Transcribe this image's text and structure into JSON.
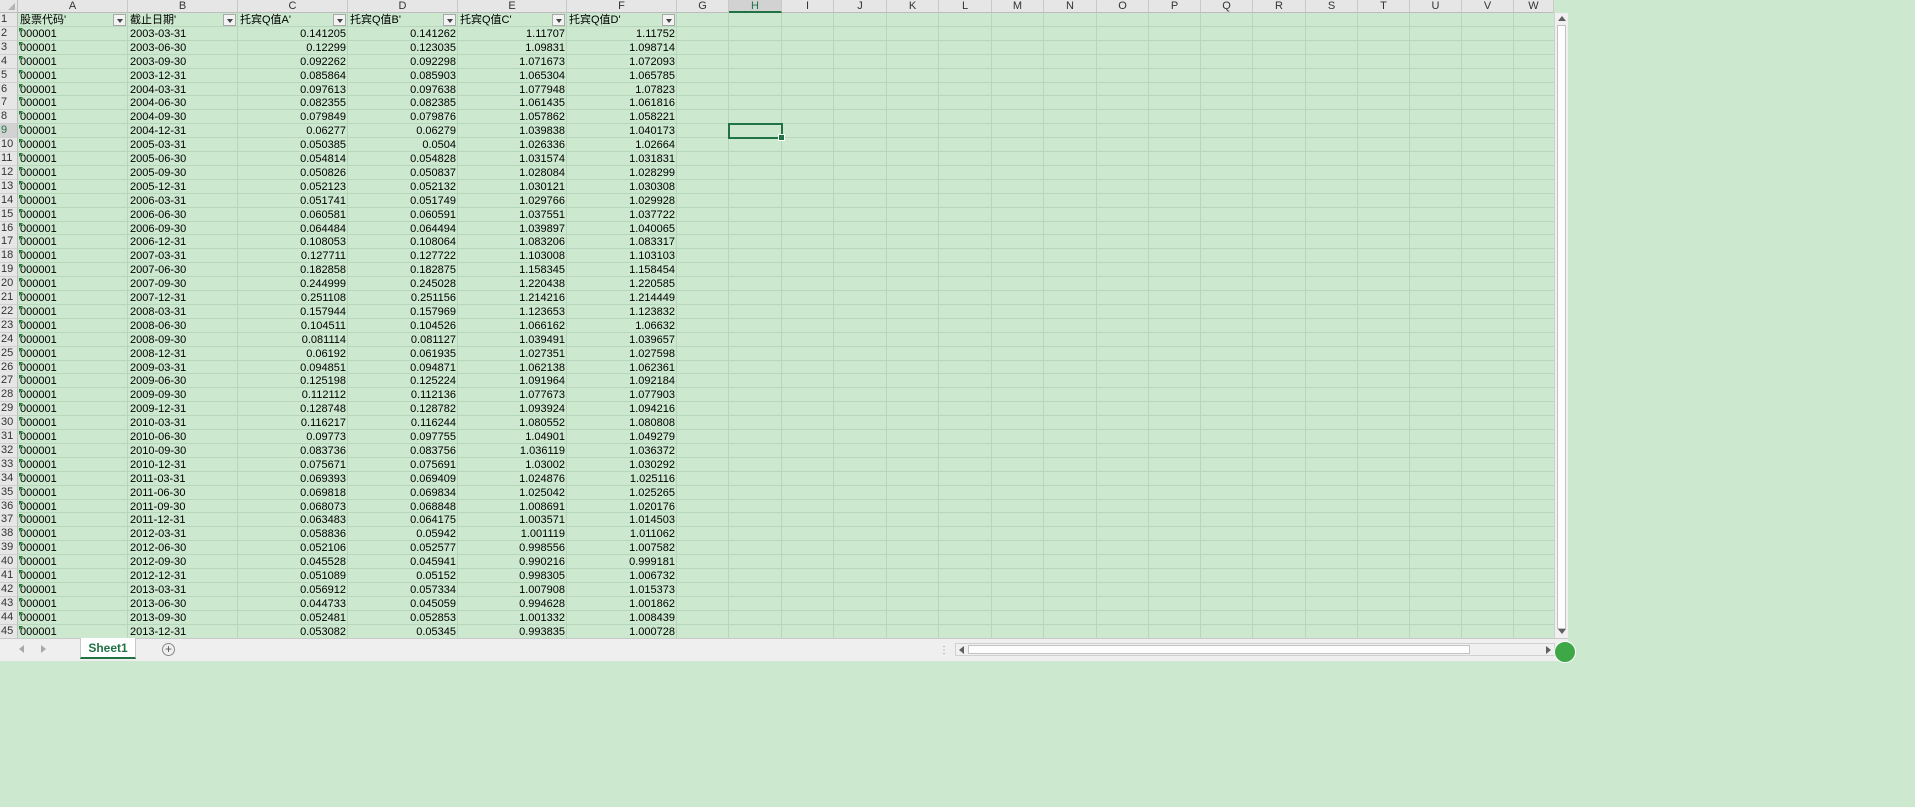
{
  "columns": [
    "A",
    "B",
    "C",
    "D",
    "E",
    "F",
    "G",
    "H",
    "I",
    "J",
    "K",
    "L",
    "M",
    "N",
    "O",
    "P",
    "Q",
    "R",
    "S",
    "T",
    "U",
    "V",
    "W"
  ],
  "selected_column": "H",
  "selected_row": "9",
  "sheet": {
    "active_tab": "Sheet1",
    "add_sheet_symbol": "+"
  },
  "header_row": {
    "row_num": "1",
    "cells": [
      "股票代码'",
      "截止日期'",
      "托宾Q值A'",
      "托宾Q值B'",
      "托宾Q值C'",
      "托宾Q值D'"
    ]
  },
  "rows": [
    {
      "n": "2",
      "code": "000001",
      "date": "2003-03-31",
      "a": "0.141205",
      "b": "0.141262",
      "c": "1.11707",
      "d": "1.11752"
    },
    {
      "n": "3",
      "code": "000001",
      "date": "2003-06-30",
      "a": "0.12299",
      "b": "0.123035",
      "c": "1.09831",
      "d": "1.098714"
    },
    {
      "n": "4",
      "code": "000001",
      "date": "2003-09-30",
      "a": "0.092262",
      "b": "0.092298",
      "c": "1.071673",
      "d": "1.072093"
    },
    {
      "n": "5",
      "code": "000001",
      "date": "2003-12-31",
      "a": "0.085864",
      "b": "0.085903",
      "c": "1.065304",
      "d": "1.065785"
    },
    {
      "n": "6",
      "code": "000001",
      "date": "2004-03-31",
      "a": "0.097613",
      "b": "0.097638",
      "c": "1.077948",
      "d": "1.07823"
    },
    {
      "n": "7",
      "code": "000001",
      "date": "2004-06-30",
      "a": "0.082355",
      "b": "0.082385",
      "c": "1.061435",
      "d": "1.061816"
    },
    {
      "n": "8",
      "code": "000001",
      "date": "2004-09-30",
      "a": "0.079849",
      "b": "0.079876",
      "c": "1.057862",
      "d": "1.058221"
    },
    {
      "n": "9",
      "code": "000001",
      "date": "2004-12-31",
      "a": "0.06277",
      "b": "0.06279",
      "c": "1.039838",
      "d": "1.040173"
    },
    {
      "n": "10",
      "code": "000001",
      "date": "2005-03-31",
      "a": "0.050385",
      "b": "0.0504",
      "c": "1.026336",
      "d": "1.02664"
    },
    {
      "n": "11",
      "code": "000001",
      "date": "2005-06-30",
      "a": "0.054814",
      "b": "0.054828",
      "c": "1.031574",
      "d": "1.031831"
    },
    {
      "n": "12",
      "code": "000001",
      "date": "2005-09-30",
      "a": "0.050826",
      "b": "0.050837",
      "c": "1.028084",
      "d": "1.028299"
    },
    {
      "n": "13",
      "code": "000001",
      "date": "2005-12-31",
      "a": "0.052123",
      "b": "0.052132",
      "c": "1.030121",
      "d": "1.030308"
    },
    {
      "n": "14",
      "code": "000001",
      "date": "2006-03-31",
      "a": "0.051741",
      "b": "0.051749",
      "c": "1.029766",
      "d": "1.029928"
    },
    {
      "n": "15",
      "code": "000001",
      "date": "2006-06-30",
      "a": "0.060581",
      "b": "0.060591",
      "c": "1.037551",
      "d": "1.037722"
    },
    {
      "n": "16",
      "code": "000001",
      "date": "2006-09-30",
      "a": "0.064484",
      "b": "0.064494",
      "c": "1.039897",
      "d": "1.040065"
    },
    {
      "n": "17",
      "code": "000001",
      "date": "2006-12-31",
      "a": "0.108053",
      "b": "0.108064",
      "c": "1.083206",
      "d": "1.083317"
    },
    {
      "n": "18",
      "code": "000001",
      "date": "2007-03-31",
      "a": "0.127711",
      "b": "0.127722",
      "c": "1.103008",
      "d": "1.103103"
    },
    {
      "n": "19",
      "code": "000001",
      "date": "2007-06-30",
      "a": "0.182858",
      "b": "0.182875",
      "c": "1.158345",
      "d": "1.158454"
    },
    {
      "n": "20",
      "code": "000001",
      "date": "2007-09-30",
      "a": "0.244999",
      "b": "0.245028",
      "c": "1.220438",
      "d": "1.220585"
    },
    {
      "n": "21",
      "code": "000001",
      "date": "2007-12-31",
      "a": "0.251108",
      "b": "0.251156",
      "c": "1.214216",
      "d": "1.214449"
    },
    {
      "n": "22",
      "code": "000001",
      "date": "2008-03-31",
      "a": "0.157944",
      "b": "0.157969",
      "c": "1.123653",
      "d": "1.123832"
    },
    {
      "n": "23",
      "code": "000001",
      "date": "2008-06-30",
      "a": "0.104511",
      "b": "0.104526",
      "c": "1.066162",
      "d": "1.06632"
    },
    {
      "n": "24",
      "code": "000001",
      "date": "2008-09-30",
      "a": "0.081114",
      "b": "0.081127",
      "c": "1.039491",
      "d": "1.039657"
    },
    {
      "n": "25",
      "code": "000001",
      "date": "2008-12-31",
      "a": "0.06192",
      "b": "0.061935",
      "c": "1.027351",
      "d": "1.027598"
    },
    {
      "n": "26",
      "code": "000001",
      "date": "2009-03-31",
      "a": "0.094851",
      "b": "0.094871",
      "c": "1.062138",
      "d": "1.062361"
    },
    {
      "n": "27",
      "code": "000001",
      "date": "2009-06-30",
      "a": "0.125198",
      "b": "0.125224",
      "c": "1.091964",
      "d": "1.092184"
    },
    {
      "n": "28",
      "code": "000001",
      "date": "2009-09-30",
      "a": "0.112112",
      "b": "0.112136",
      "c": "1.077673",
      "d": "1.077903"
    },
    {
      "n": "29",
      "code": "000001",
      "date": "2009-12-31",
      "a": "0.128748",
      "b": "0.128782",
      "c": "1.093924",
      "d": "1.094216"
    },
    {
      "n": "30",
      "code": "000001",
      "date": "2010-03-31",
      "a": "0.116217",
      "b": "0.116244",
      "c": "1.080552",
      "d": "1.080808"
    },
    {
      "n": "31",
      "code": "000001",
      "date": "2010-06-30",
      "a": "0.09773",
      "b": "0.097755",
      "c": "1.04901",
      "d": "1.049279"
    },
    {
      "n": "32",
      "code": "000001",
      "date": "2010-09-30",
      "a": "0.083736",
      "b": "0.083756",
      "c": "1.036119",
      "d": "1.036372"
    },
    {
      "n": "33",
      "code": "000001",
      "date": "2010-12-31",
      "a": "0.075671",
      "b": "0.075691",
      "c": "1.03002",
      "d": "1.030292"
    },
    {
      "n": "34",
      "code": "000001",
      "date": "2011-03-31",
      "a": "0.069393",
      "b": "0.069409",
      "c": "1.024876",
      "d": "1.025116"
    },
    {
      "n": "35",
      "code": "000001",
      "date": "2011-06-30",
      "a": "0.069818",
      "b": "0.069834",
      "c": "1.025042",
      "d": "1.025265"
    },
    {
      "n": "36",
      "code": "000001",
      "date": "2011-09-30",
      "a": "0.068073",
      "b": "0.068848",
      "c": "1.008691",
      "d": "1.020176"
    },
    {
      "n": "37",
      "code": "000001",
      "date": "2011-12-31",
      "a": "0.063483",
      "b": "0.064175",
      "c": "1.003571",
      "d": "1.014503"
    },
    {
      "n": "38",
      "code": "000001",
      "date": "2012-03-31",
      "a": "0.058836",
      "b": "0.05942",
      "c": "1.001119",
      "d": "1.011062"
    },
    {
      "n": "39",
      "code": "000001",
      "date": "2012-06-30",
      "a": "0.052106",
      "b": "0.052577",
      "c": "0.998556",
      "d": "1.007582"
    },
    {
      "n": "40",
      "code": "000001",
      "date": "2012-09-30",
      "a": "0.045528",
      "b": "0.045941",
      "c": "0.990216",
      "d": "0.999181"
    },
    {
      "n": "41",
      "code": "000001",
      "date": "2012-12-31",
      "a": "0.051089",
      "b": "0.05152",
      "c": "0.998305",
      "d": "1.006732"
    },
    {
      "n": "42",
      "code": "000001",
      "date": "2013-03-31",
      "a": "0.056912",
      "b": "0.057334",
      "c": "1.007908",
      "d": "1.015373"
    },
    {
      "n": "43",
      "code": "000001",
      "date": "2013-06-30",
      "a": "0.044733",
      "b": "0.045059",
      "c": "0.994628",
      "d": "1.001862"
    },
    {
      "n": "44",
      "code": "000001",
      "date": "2013-09-30",
      "a": "0.052481",
      "b": "0.052853",
      "c": "1.001332",
      "d": "1.008439"
    },
    {
      "n": "45",
      "code": "000001",
      "date": "2013-12-31",
      "a": "0.053082",
      "b": "0.05345",
      "c": "0.993835",
      "d": "1.000728"
    }
  ]
}
